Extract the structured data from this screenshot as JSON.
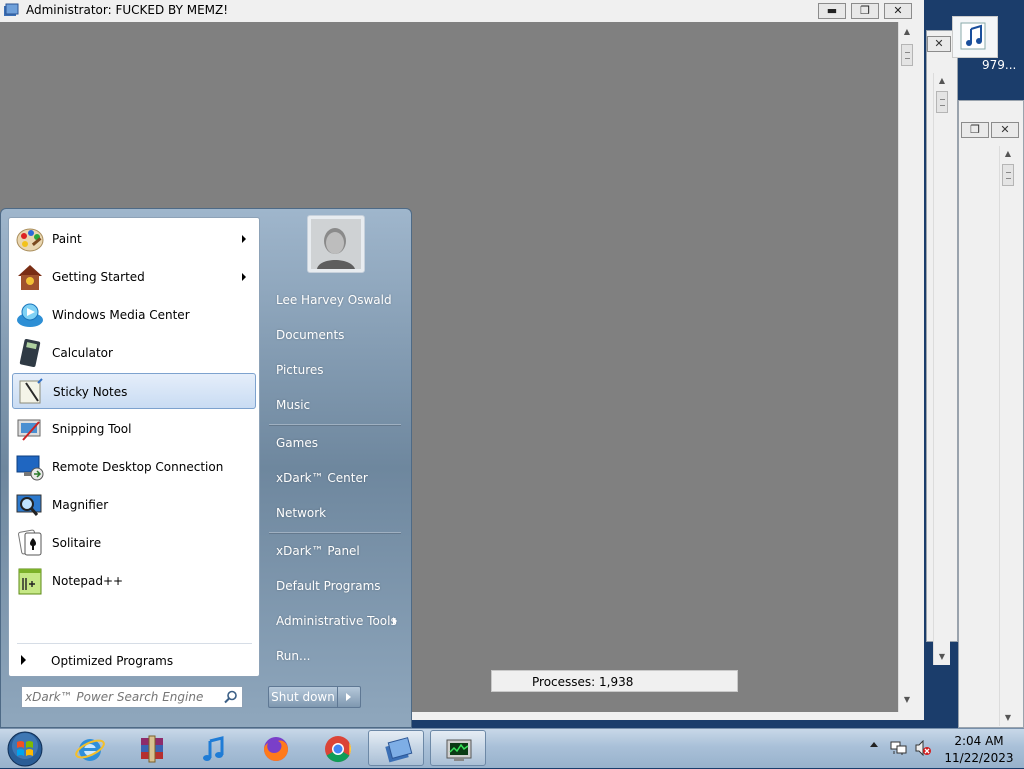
{
  "window": {
    "title": "Administrator:  FUCKED BY MEMZ!",
    "minimize": "▬",
    "restore": "❐",
    "close": "✕"
  },
  "background_windows": {
    "close": "✕",
    "restore": "❐",
    "fragment_text": "979..."
  },
  "start_menu": {
    "programs": [
      {
        "label": "Paint",
        "icon": "paint-icon",
        "submenu": true
      },
      {
        "label": "Getting Started",
        "icon": "getting-started-icon",
        "submenu": true
      },
      {
        "label": "Windows Media Center",
        "icon": "media-center-icon",
        "submenu": false
      },
      {
        "label": "Calculator",
        "icon": "calculator-icon",
        "submenu": false
      },
      {
        "label": "Sticky Notes",
        "icon": "sticky-notes-icon",
        "submenu": false,
        "highlighted": true
      },
      {
        "label": "Snipping Tool",
        "icon": "snipping-tool-icon",
        "submenu": false
      },
      {
        "label": "Remote Desktop Connection",
        "icon": "remote-desktop-icon",
        "submenu": false
      },
      {
        "label": "Magnifier",
        "icon": "magnifier-icon",
        "submenu": false
      },
      {
        "label": "Solitaire",
        "icon": "solitaire-icon",
        "submenu": false
      },
      {
        "label": "Notepad++",
        "icon": "notepadpp-icon",
        "submenu": false
      }
    ],
    "all_programs": "Optimized Programs",
    "search_placeholder": "xDark™ Power Search Engine",
    "right_links": {
      "user": "Lee Harvey Oswald",
      "documents": "Documents",
      "pictures": "Pictures",
      "music": "Music",
      "games": "Games",
      "center": "xDark™ Center",
      "network": "Network",
      "panel": "xDark™ Panel",
      "default_programs": "Default Programs",
      "admin_tools": "Administrative Tools",
      "run": "Run..."
    },
    "shutdown": "Shut down"
  },
  "status": {
    "processes": "Processes: 1,938"
  },
  "taskbar": {
    "pinned": [
      "internet-explorer-icon",
      "winrar-icon",
      "itunes-icon",
      "firefox-icon",
      "chrome-icon",
      "cmd-window-icon",
      "task-manager-icon"
    ],
    "clock_time": "2:04 AM",
    "clock_date": "11/22/2023"
  },
  "colors": {
    "client_bg": "#808080",
    "startmenu_accent": "#6e879e",
    "highlight": "#c9dcf3"
  }
}
